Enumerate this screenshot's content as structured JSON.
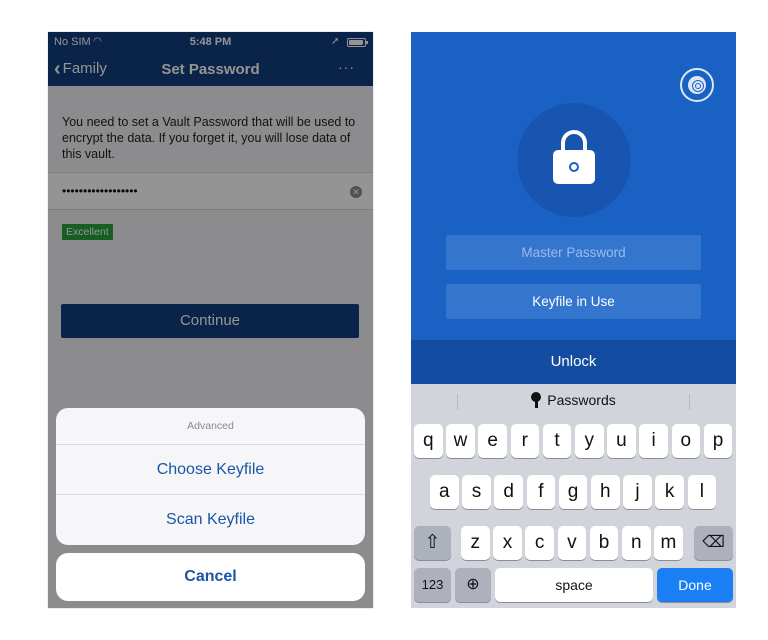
{
  "left_screen": {
    "status_bar": {
      "carrier": "No SIM",
      "time": "5:48 PM"
    },
    "nav": {
      "back_label": "Family",
      "title": "Set Password",
      "more": "···"
    },
    "description": "You need to set a Vault Password that will be used to encrypt the data. If you forget it, you will lose data of this vault.",
    "password_value": "••••••••••••••••••",
    "strength_badge": "Excellent",
    "continue_label": "Continue",
    "action_sheet": {
      "title": "Advanced",
      "items": [
        "Choose Keyfile",
        "Scan Keyfile"
      ],
      "cancel_label": "Cancel"
    },
    "colors": {
      "nav": "#123e7e",
      "link": "#1a56a8",
      "badge": "#27a33a"
    }
  },
  "right_screen": {
    "master_password_placeholder": "Master Password",
    "keyfile_label": "Keyfile in Use",
    "unlock_label": "Unlock",
    "keyboard": {
      "suggestion": "Passwords",
      "row1": [
        "q",
        "w",
        "e",
        "r",
        "t",
        "y",
        "u",
        "i",
        "o",
        "p"
      ],
      "row2": [
        "a",
        "s",
        "d",
        "f",
        "g",
        "h",
        "j",
        "k",
        "l"
      ],
      "row3": [
        "z",
        "x",
        "c",
        "v",
        "b",
        "n",
        "m"
      ],
      "numbers_key": "123",
      "space_key": "space",
      "done_key": "Done"
    },
    "colors": {
      "background": "#1a61c4",
      "unlock_bar": "#134ca0",
      "done_key": "#1a7ff5"
    }
  }
}
